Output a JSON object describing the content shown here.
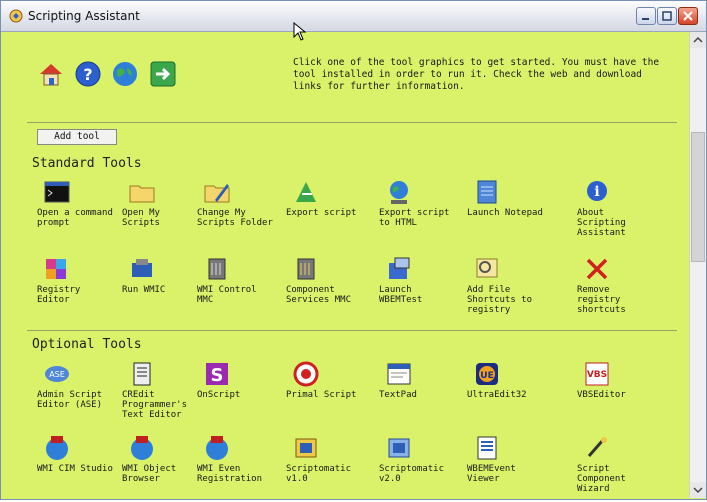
{
  "window": {
    "title": "Scripting Assistant",
    "controls": {
      "minimize": "minimize",
      "maximize": "maximize",
      "close": "close"
    }
  },
  "header": {
    "icons": [
      "home-icon",
      "help-icon",
      "web-globe-icon",
      "go-arrow-icon"
    ],
    "info": "Click one of the tool graphics to get started. You must have the tool installed in order to run it. Check the web and download links for further information."
  },
  "add_tool_label": "Add tool",
  "standard": {
    "title": "Standard Tools",
    "tools": [
      {
        "label": "Open a command prompt",
        "icon": "command-prompt-icon"
      },
      {
        "label": "Open My Scripts",
        "icon": "folder-icon"
      },
      {
        "label": "Change My Scripts Folder",
        "icon": "folder-pencil-icon"
      },
      {
        "label": "Export script",
        "icon": "export-icon"
      },
      {
        "label": "Export script to HTML",
        "icon": "globe-export-icon"
      },
      {
        "label": "Launch Notepad",
        "icon": "notepad-icon"
      },
      {
        "label": "About Scripting Assistant",
        "icon": "info-icon"
      },
      {
        "label": "Registry Editor",
        "icon": "registry-icon"
      },
      {
        "label": "Run WMIC",
        "icon": "wmic-icon"
      },
      {
        "label": "WMI Control MMC",
        "icon": "wmi-control-icon"
      },
      {
        "label": "Component Services MMC",
        "icon": "component-services-icon"
      },
      {
        "label": "Launch WBEMTest",
        "icon": "wbemtest-icon"
      },
      {
        "label": "Add File Shortcuts to registry",
        "icon": "add-shortcut-icon"
      },
      {
        "label": "Remove registry shortcuts",
        "icon": "remove-x-icon"
      }
    ]
  },
  "optional": {
    "title": "Optional Tools",
    "tools": [
      {
        "label": "Admin Script Editor (ASE)",
        "icon": "ase-icon"
      },
      {
        "label": "CREdit Programmer's Text Editor",
        "icon": "credit-icon"
      },
      {
        "label": "OnScript",
        "icon": "onscript-icon"
      },
      {
        "label": "Primal Script",
        "icon": "primalscript-icon"
      },
      {
        "label": "TextPad",
        "icon": "textpad-icon"
      },
      {
        "label": "UltraEdit32",
        "icon": "ultraedit-icon"
      },
      {
        "label": "VBSEditor",
        "icon": "vbseditor-icon"
      },
      {
        "label": "WMI CIM Studio",
        "icon": "wmi-cim-icon"
      },
      {
        "label": "WMI Object Browser",
        "icon": "wmi-object-icon"
      },
      {
        "label": "WMI Even Registration",
        "icon": "wmi-event-reg-icon"
      },
      {
        "label": "Scriptomatic v1.0",
        "icon": "scriptomatic1-icon"
      },
      {
        "label": "Scriptomatic v2.0",
        "icon": "scriptomatic2-icon"
      },
      {
        "label": "WBEMEvent Viewer",
        "icon": "wbem-event-viewer-icon"
      },
      {
        "label": "Script Component Wizard",
        "icon": "script-component-wizard-icon"
      }
    ]
  },
  "colors": {
    "background": "#d9f26a",
    "titlebar": "#e3e6ee",
    "close_button": "#d6442a"
  }
}
